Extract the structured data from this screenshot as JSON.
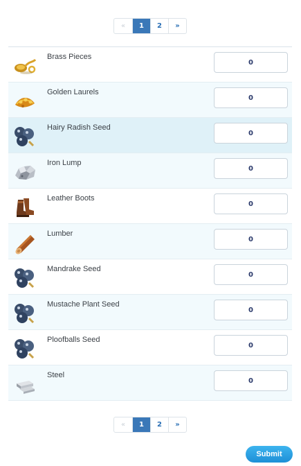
{
  "pagination": {
    "prev": "«",
    "pages": [
      "1",
      "2"
    ],
    "next": "»",
    "active_page": "1"
  },
  "items": [
    {
      "name": "Brass Pieces",
      "qty": "0",
      "icon": "brass-pieces-icon"
    },
    {
      "name": "Golden Laurels",
      "qty": "0",
      "icon": "golden-laurels-icon"
    },
    {
      "name": "Hairy Radish Seed",
      "qty": "0",
      "icon": "seed-bag-icon"
    },
    {
      "name": "Iron Lump",
      "qty": "0",
      "icon": "iron-lump-icon"
    },
    {
      "name": "Leather Boots",
      "qty": "0",
      "icon": "leather-boots-icon"
    },
    {
      "name": "Lumber",
      "qty": "0",
      "icon": "lumber-icon"
    },
    {
      "name": "Mandrake Seed",
      "qty": "0",
      "icon": "seed-bag-icon"
    },
    {
      "name": "Mustache Plant Seed",
      "qty": "0",
      "icon": "seed-bag-icon"
    },
    {
      "name": "Ploofballs Seed",
      "qty": "0",
      "icon": "seed-bag-icon"
    },
    {
      "name": "Steel",
      "qty": "0",
      "icon": "steel-icon"
    }
  ],
  "submit_label": "Submit",
  "colors": {
    "accent": "#3a78b8",
    "row_alt": "#f2fafd",
    "row_highlight": "#dff1f8",
    "submit": "#1e8fd6"
  }
}
